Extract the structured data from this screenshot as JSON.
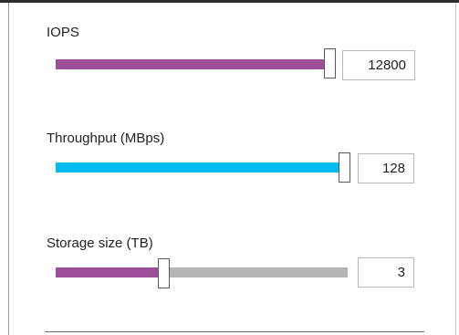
{
  "sliders": [
    {
      "label": "IOPS",
      "value": "12800",
      "fill_fraction": 1.0,
      "fill_color": "#9d4e98",
      "rest_color": "#b5b5b5"
    },
    {
      "label": "Throughput (MBps)",
      "value": "128",
      "fill_fraction": 1.0,
      "fill_color": "#00bcf2",
      "rest_color": "#b5b5b5"
    },
    {
      "label": "Storage size (TB)",
      "value": "3",
      "fill_fraction": 0.37,
      "fill_color": "#9d4e98",
      "rest_color": "#b5b5b5"
    }
  ]
}
